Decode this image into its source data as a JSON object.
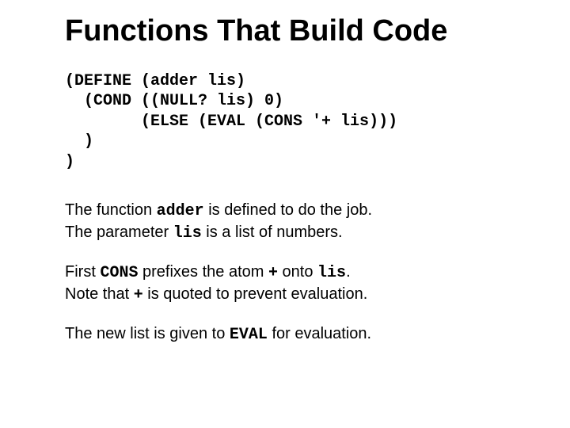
{
  "title": "Functions That Build Code",
  "code": {
    "l1": "(DEFINE (adder lis)",
    "l2": "  (COND ((NULL? lis) 0)",
    "l3": "        (ELSE (EVAL (CONS '+ lis)))",
    "l4": "  )",
    "l5": ")"
  },
  "p1": {
    "t1": "The function ",
    "c1": "adder",
    "t2": " is defined to do the job.",
    "t3": "The parameter ",
    "c2": "lis",
    "t4": " is a list of numbers."
  },
  "p2": {
    "t1": "First ",
    "c1": "CONS",
    "t2": " prefixes the atom ",
    "c2": "+",
    "t3": " onto ",
    "c3": "lis",
    "t4": ".",
    "t5": "Note that ",
    "c4": "+",
    "t6": " is quoted to prevent evaluation."
  },
  "p3": {
    "t1": "The new list is given to ",
    "c1": "EVAL",
    "t2": " for evaluation."
  }
}
